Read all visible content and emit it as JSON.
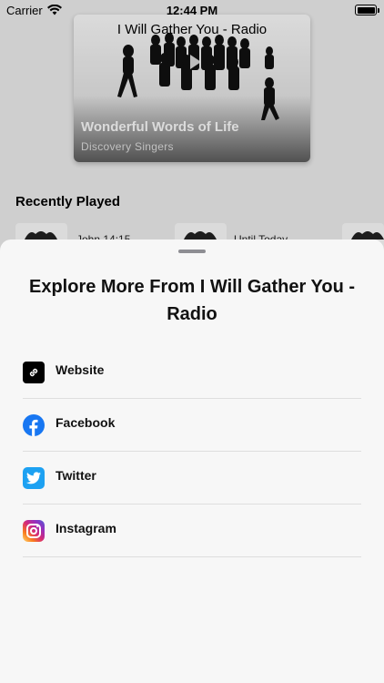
{
  "status_bar": {
    "carrier": "Carrier",
    "time": "12:44 PM"
  },
  "nav": {
    "title": "I Will Gather You - Radio"
  },
  "now_playing": {
    "title": "Wonderful Words of Life",
    "artist": "Discovery Singers"
  },
  "recently_played": {
    "heading": "Recently Played",
    "items": [
      {
        "label": "John 14:15"
      },
      {
        "label": "Until Today"
      }
    ]
  },
  "sheet": {
    "title": "Explore More From I Will Gather You - Radio",
    "links": [
      {
        "label": "Website",
        "icon": "link-icon",
        "color": "#000000"
      },
      {
        "label": "Facebook",
        "icon": "facebook-icon",
        "color": "#1877f2"
      },
      {
        "label": "Twitter",
        "icon": "twitter-icon",
        "color": "#1da1f2"
      },
      {
        "label": "Instagram",
        "icon": "instagram-icon",
        "color": "#d62976"
      }
    ]
  }
}
